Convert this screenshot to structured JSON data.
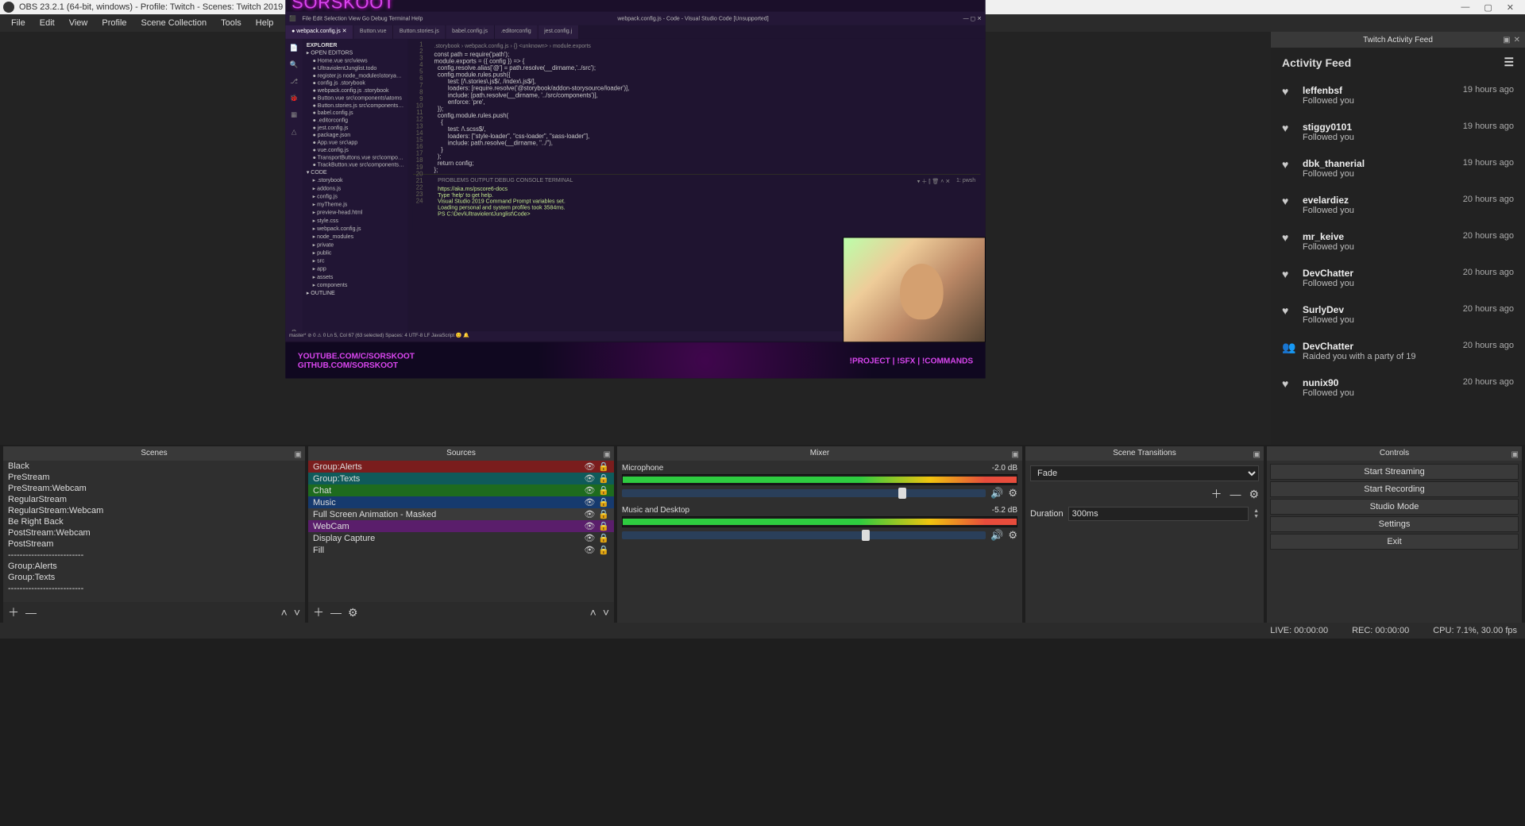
{
  "window": {
    "title": "OBS 23.2.1 (64-bit, windows) - Profile: Twitch - Scenes: Twitch 2019"
  },
  "menu": [
    "File",
    "Edit",
    "View",
    "Profile",
    "Scene Collection",
    "Tools",
    "Help"
  ],
  "activity": {
    "dockTitle": "Twitch Activity Feed",
    "header": "Activity Feed",
    "items": [
      {
        "icon": "♥",
        "user": "leffenbsf",
        "sub": "Followed you",
        "time": "19 hours ago"
      },
      {
        "icon": "♥",
        "user": "stiggy0101",
        "sub": "Followed you",
        "time": "19 hours ago"
      },
      {
        "icon": "♥",
        "user": "dbk_thanerial",
        "sub": "Followed you",
        "time": "19 hours ago"
      },
      {
        "icon": "♥",
        "user": "evelardiez",
        "sub": "Followed you",
        "time": "20 hours ago"
      },
      {
        "icon": "♥",
        "user": "mr_keive",
        "sub": "Followed you",
        "time": "20 hours ago"
      },
      {
        "icon": "♥",
        "user": "DevChatter",
        "sub": "Followed you",
        "time": "20 hours ago"
      },
      {
        "icon": "♥",
        "user": "SurlyDev",
        "sub": "Followed you",
        "time": "20 hours ago"
      },
      {
        "icon": "👥",
        "user": "DevChatter",
        "sub": "Raided you with a party of 19",
        "time": "20 hours ago"
      },
      {
        "icon": "♥",
        "user": "nunix90",
        "sub": "Followed you",
        "time": "20 hours ago"
      }
    ]
  },
  "scenes": {
    "title": "Scenes",
    "list": [
      "Black",
      "PreStream",
      "PreStream:Webcam",
      "RegularStream",
      "RegularStream:Webcam",
      "Be Right Back",
      "PostStream:Webcam",
      "PostStream",
      "--------------------------",
      "Group:Alerts",
      "Group:Texts",
      "--------------------------"
    ]
  },
  "sources": {
    "title": "Sources",
    "list": [
      {
        "label": "Group:Alerts",
        "cls": "c-red"
      },
      {
        "label": "Group:Texts",
        "cls": "c-teal"
      },
      {
        "label": "Chat",
        "cls": "c-green"
      },
      {
        "label": "Music",
        "cls": "c-blue"
      },
      {
        "label": "Full Screen Animation - Masked",
        "cls": "c-grey"
      },
      {
        "label": "WebCam",
        "cls": "c-purp"
      },
      {
        "label": "Display Capture",
        "cls": ""
      },
      {
        "label": "Fill",
        "cls": ""
      }
    ]
  },
  "mixer": {
    "title": "Mixer",
    "channels": [
      {
        "name": "Microphone",
        "db": "-2.0 dB",
        "knob": 76
      },
      {
        "name": "Music and Desktop",
        "db": "-5.2 dB",
        "knob": 66
      }
    ]
  },
  "transitions": {
    "title": "Scene Transitions",
    "fade": "Fade",
    "durLabel": "Duration",
    "dur": "300ms"
  },
  "controls": {
    "title": "Controls",
    "buttons": [
      "Start Streaming",
      "Start Recording",
      "Studio Mode",
      "Settings",
      "Exit"
    ]
  },
  "status": {
    "live": "LIVE: 00:00:00",
    "rec": "REC: 00:00:00",
    "cpu": "CPU: 7.1%, 30.00 fps"
  },
  "preview": {
    "brand": "SORSKOOT",
    "vscodeTitle": "webpack.config.js - Code - Visual Studio Code [Unsupported]",
    "vscodeMenu": [
      "File",
      "Edit",
      "Selection",
      "View",
      "Go",
      "Debug",
      "Terminal",
      "Help"
    ],
    "tabs": [
      "webpack.config.js",
      "Button.vue",
      "Button.stories.js",
      "babel.config.js",
      ".editorconfig",
      "jest.config.j"
    ],
    "breadcrumb": ".storybook › webpack.config.js › {} <unknown> › module.exports",
    "explorer": {
      "title": "EXPLORER",
      "openEditors": "OPEN EDITORS",
      "files": [
        "Home.vue  src\\views",
        "UltraviolentJunglist.todo",
        "register.js  node_modules\\storyasrc-addon-vue-inf...",
        "config.js  .storybook",
        "webpack.config.js  .storybook",
        "Button.vue  src\\components\\atoms",
        "Button.stories.js  src\\components\\atoms",
        "babel.config.js",
        ".editorconfig",
        "jest.config.js",
        "package.json",
        "App.vue  src\\app",
        "vue.config.js",
        "TransportButtons.vue  src\\components\\organisms",
        "TrackButton.vue  src\\components\\atoms"
      ],
      "code": "CODE",
      "tree": [
        ".storybook",
        "addons.js",
        "config.js",
        "myTheme.js",
        "preview-head.html",
        "style.css",
        "webpack.config.js",
        "node_modules",
        "private",
        "public",
        "src",
        "app",
        "assets",
        "components"
      ],
      "outline": "OUTLINE"
    },
    "code": [
      "const path = require('path');",
      "",
      "module.exports = ({ config }) => {",
      "",
      "  config.resolve.alias['@'] = path.resolve(__dirname,'../src');",
      "",
      "  config.module.rules.push({",
      "        test: [/\\.stories\\.js$/, /index\\.js$/],",
      "        loaders: [require.resolve('@storybook/addon-storysource/loader')],",
      "        include: [path.resolve(__dirname, '../src/components')],",
      "        enforce: 'pre',",
      "",
      "  });",
      "",
      "  config.module.rules.push(",
      "    {",
      "        test: /\\.scss$/,",
      "        loaders: [\"style-loader\", \"css-loader\", \"sass-loader\"],",
      "        include: path.resolve(__dirname, \"../\"),",
      "    }",
      "  );",
      "  return config;",
      "};",
      ""
    ],
    "terminalTabs": "PROBLEMS   OUTPUT   DEBUG CONSOLE   TERMINAL",
    "terminalShell": "1: pwsh",
    "terminal": [
      "https://aka.ms/pscore6-docs",
      "Type 'help' to get help.",
      "",
      "Visual Studio 2019 Command Prompt variables set.",
      "Loading personal and system profiles took 3584ms.",
      "PS C:\\Dev\\UltraviolentJunglist\\Code>"
    ],
    "statusline": "master*   ⊘ 0 ⚠ 0                                                  Ln 5, Col 67 (63 selected)   Spaces: 4   UTF-8   LF   JavaScript   😊  🔔",
    "bannerLeft1": "YOUTUBE.COM/C/SORSKOOT",
    "bannerLeft2": "GITHUB.COM/SORSKOOT",
    "bannerRight": "!PROJECT | !SFX | !COMMANDS"
  }
}
